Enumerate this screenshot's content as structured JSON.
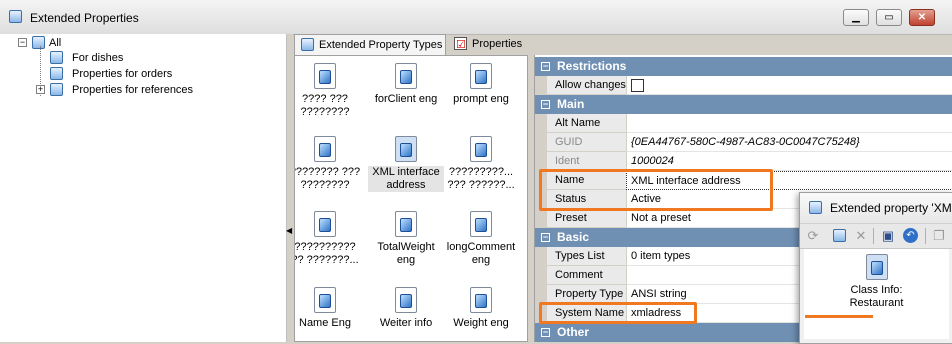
{
  "window": {
    "title": "Extended Properties"
  },
  "tree": {
    "root": {
      "label": "All",
      "expander": "−"
    },
    "items": [
      {
        "label": "For dishes"
      },
      {
        "label": "Properties for orders"
      },
      {
        "label": "Properties for references",
        "expander": "+"
      }
    ]
  },
  "tabs": [
    {
      "label": "Extended Property Types",
      "active": true
    },
    {
      "label": "Properties",
      "active": false
    }
  ],
  "icons": [
    {
      "label": "???? ??? ????????"
    },
    {
      "label": "forClient eng"
    },
    {
      "label": "prompt eng"
    },
    {
      "label": "???????? ??? ????????"
    },
    {
      "label": "XML interface address",
      "selected": true
    },
    {
      "label": "?????????... ??? ??????..."
    },
    {
      "label": "?????????? ?? ???????..."
    },
    {
      "label": "TotalWeight eng"
    },
    {
      "label": "longComment eng"
    },
    {
      "label": "Name Eng"
    },
    {
      "label": "Weiter info"
    },
    {
      "label": "Weight eng"
    }
  ],
  "grid": {
    "categories": {
      "restrictions": "Restrictions",
      "main": "Main",
      "basic": "Basic",
      "other": "Other"
    },
    "toggle": "−",
    "rows": {
      "allow_changes": {
        "name": "Allow changes",
        "checked": false
      },
      "alt_name": {
        "name": "Alt Name",
        "value": ""
      },
      "guid": {
        "name": "GUID",
        "value": "{0EA44767-580C-4987-AC83-0C0047C75248}"
      },
      "ident": {
        "name": "Ident",
        "value": "1000024"
      },
      "name": {
        "name": "Name",
        "value": "XML interface address"
      },
      "status": {
        "name": "Status",
        "value": "Active"
      },
      "preset": {
        "name": "Preset",
        "value": "Not a preset"
      },
      "types_list": {
        "name": "Types List",
        "value": "0 item types"
      },
      "comment": {
        "name": "Comment",
        "value": ""
      },
      "property_type": {
        "name": "Property Type",
        "value": "ANSI string"
      },
      "system_name": {
        "name": "System Name",
        "value": "xmladress"
      }
    }
  },
  "popup": {
    "title": "Extended property 'XML",
    "item_label_line1": "Class Info:",
    "item_label_line2": "Restaurant"
  },
  "colors": {
    "highlight": "#f07820",
    "category": "#6f8fb3"
  }
}
